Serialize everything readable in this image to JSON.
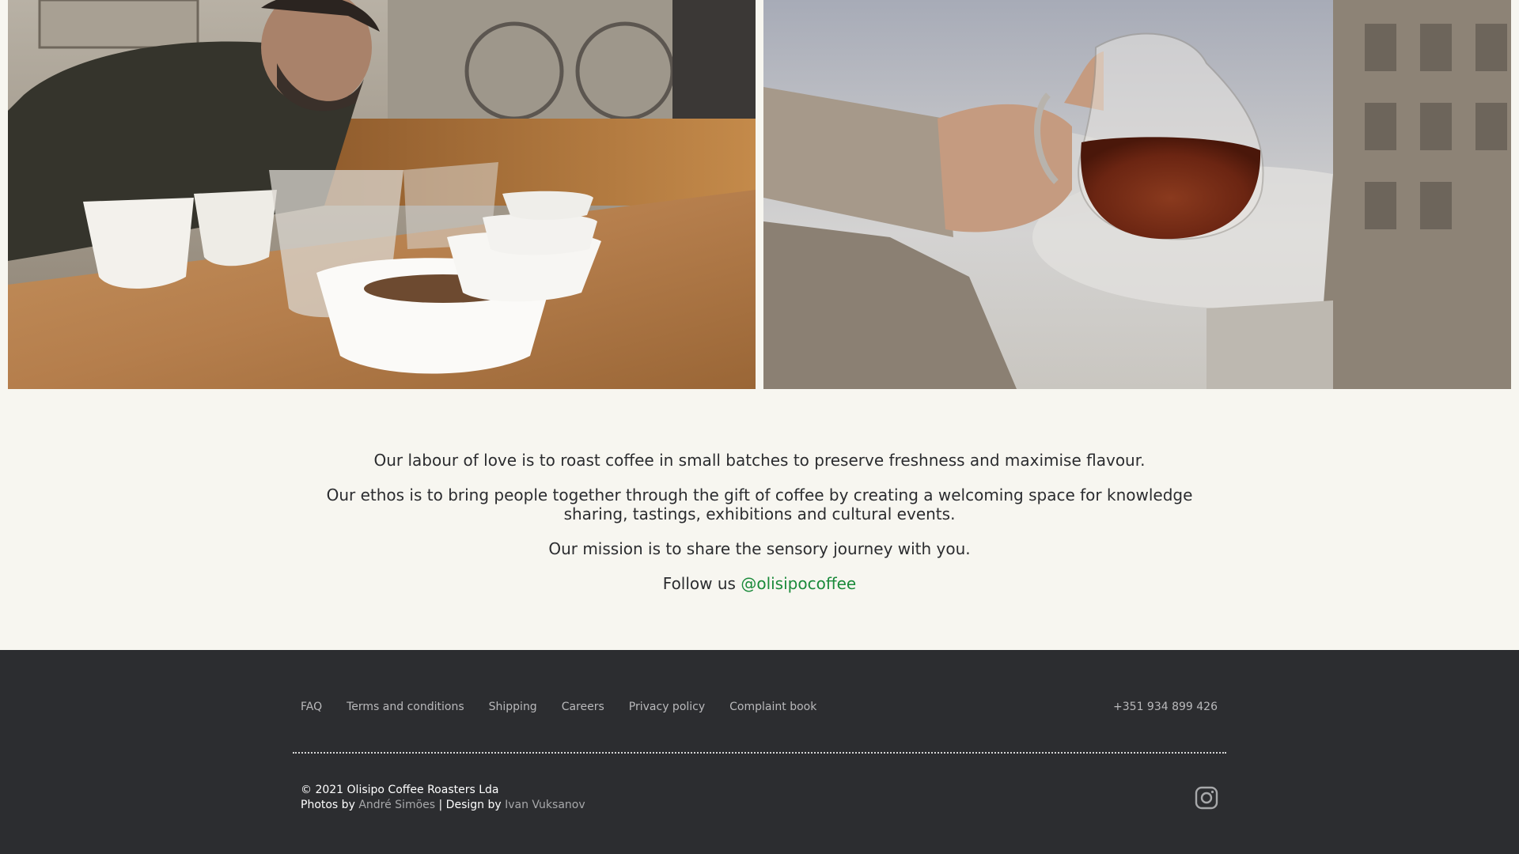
{
  "about": {
    "line1": "Our labour of love is to roast coffee in small batches to preserve freshness and maximise flavour.",
    "line2a": "Our ethos is to bring people together through the gift of coffee by creating a welcoming space for knowledge",
    "line2b": "sharing, tastings, exhibitions and cultural events.",
    "line3": "Our mission is to share the sensory journey with you.",
    "follow_label": "Follow us",
    "follow_handle": "@olisipocoffee"
  },
  "footer": {
    "nav": [
      {
        "label": "FAQ"
      },
      {
        "label": "Terms and conditions"
      },
      {
        "label": "Shipping"
      },
      {
        "label": "Careers"
      },
      {
        "label": "Privacy policy"
      },
      {
        "label": "Complaint book"
      }
    ],
    "phone": "+351 934 899 426",
    "copyright": "© 2021 Olisipo Coffee Roasters Lda",
    "photos_by_label": "Photos by",
    "photographer": "André Simões",
    "design_by_label": "| Design by",
    "designer": "Ivan Vuksanov"
  },
  "colors": {
    "background": "#f7f6f0",
    "footer_bg": "#2c2d30",
    "link_green": "#1a8a3a"
  },
  "icons": {
    "social": "instagram-icon"
  }
}
